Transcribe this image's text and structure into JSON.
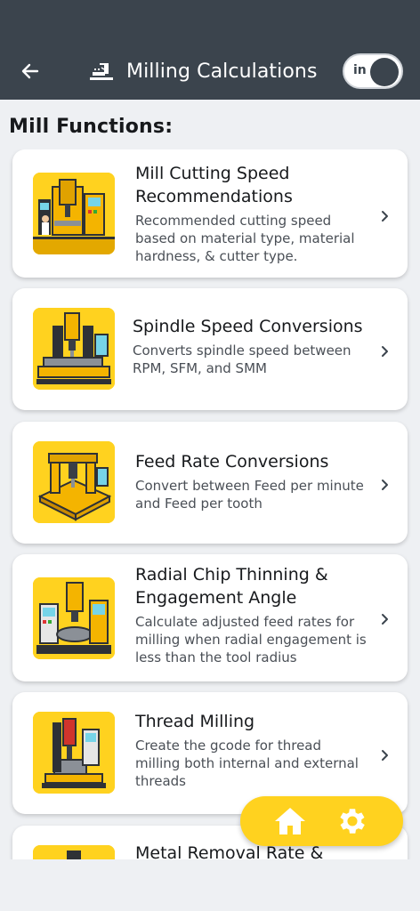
{
  "header": {
    "title": "Milling Calculations",
    "toggle_label": "in",
    "back_icon": "arrow-left-icon",
    "title_icon": "milling-machine-icon"
  },
  "section": {
    "title": "Mill Functions:"
  },
  "cards": [
    {
      "title": "Mill Cutting Speed Recommendations",
      "description": "Recommended cutting speed based on material type, material hardness, & cutter type."
    },
    {
      "title": "Spindle Speed Conversions",
      "description": "Converts spindle speed between RPM, SFM, and SMM"
    },
    {
      "title": "Feed Rate Conversions",
      "description": "Convert between Feed per minute and Feed per tooth"
    },
    {
      "title": "Radial Chip Thinning & Engagement Angle",
      "description": "Calculate adjusted feed rates for milling  when radial engagement is less than the tool radius"
    },
    {
      "title": "Thread Milling",
      "description": "Create the gcode for thread milling both internal and external threads"
    },
    {
      "title": "Metal Removal Rate &",
      "description": ""
    }
  ],
  "fab": {
    "home_icon": "home-icon",
    "settings_icon": "gear-icon"
  },
  "colors": {
    "header_bg": "#3b444d",
    "accent_yellow": "#ffd21f",
    "page_bg": "#eef0f3",
    "card_bg": "#ffffff"
  }
}
